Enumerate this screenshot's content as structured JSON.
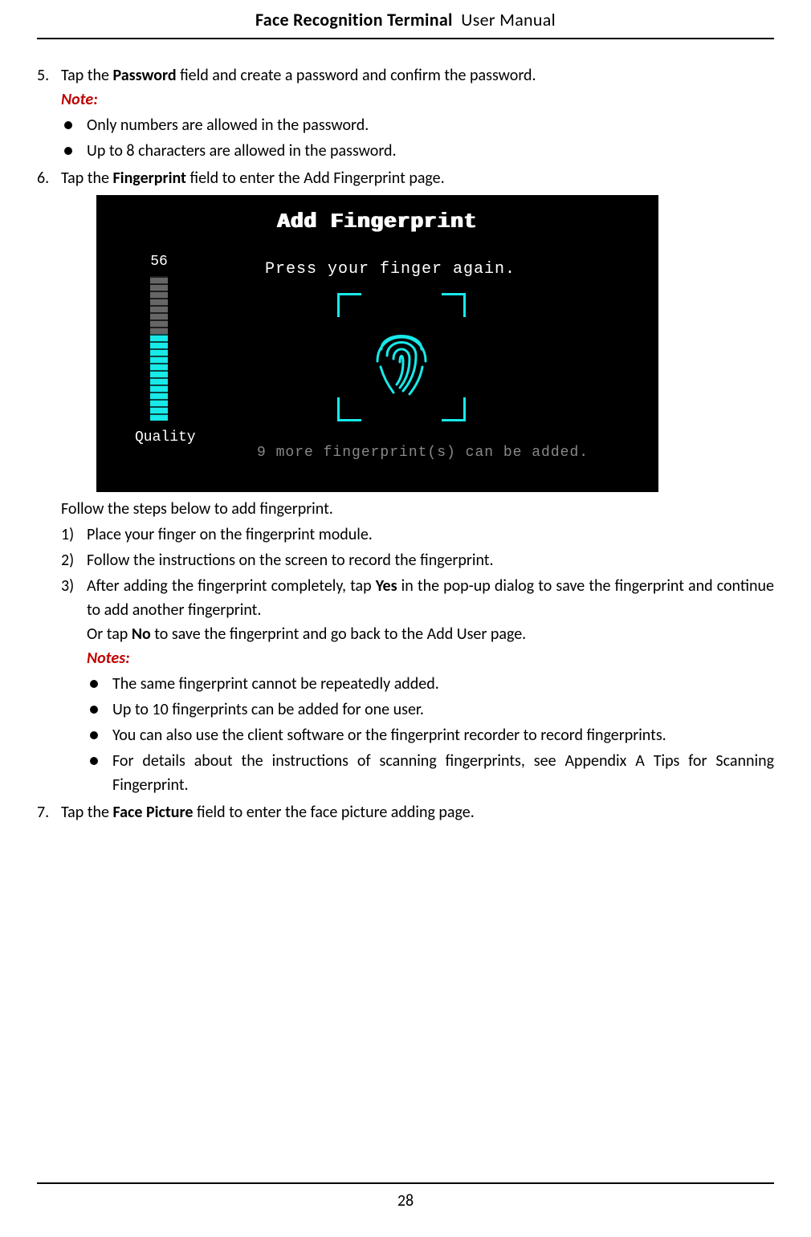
{
  "header": {
    "title_bold": "Face Recognition Terminal",
    "title_light": "User Manual"
  },
  "steps": {
    "s5": {
      "num": "5.",
      "text_pre": "Tap the ",
      "text_bold": "Password",
      "text_post": " field and create a password and confirm the password.",
      "note_label": "Note:",
      "bullets": [
        "Only numbers are allowed in the password.",
        "Up to 8 characters are allowed in the password."
      ]
    },
    "s6": {
      "num": "6.",
      "text_pre": "Tap the ",
      "text_bold": "Fingerprint",
      "text_post": " field to enter the Add Fingerprint page.",
      "screenshot": {
        "title": "Add Fingerprint",
        "quality_value": "56",
        "quality_label": "Quality",
        "prompt": "Press your finger again.",
        "remaining": "9 more fingerprint(s) can be added."
      },
      "follow_intro": "Follow the steps below to add fingerprint.",
      "substeps": {
        "a": {
          "num": "1)",
          "text": "Place your finger on the fingerprint module."
        },
        "b": {
          "num": "2)",
          "text": "Follow the instructions on the screen to record the fingerprint."
        },
        "c": {
          "num": "3)",
          "line1_pre": "After adding the fingerprint completely, tap ",
          "line1_bold": "Yes",
          "line1_post": " in the pop-up dialog to save the fingerprint and continue to add another fingerprint.",
          "line2_pre": "Or tap ",
          "line2_bold": "No",
          "line2_post": " to save the fingerprint and go back to the Add User page.",
          "notes_label": "Notes:",
          "note_bullets": [
            "The same fingerprint cannot be repeatedly added.",
            "Up to 10 fingerprints can be added for one user.",
            "You can also use the client software or the fingerprint recorder to record fingerprints.",
            "For details about the instructions of scanning fingerprints, see Appendix A  Tips for Scanning Fingerprint."
          ]
        }
      }
    },
    "s7": {
      "num": "7.",
      "text_pre": "Tap the ",
      "text_bold": "Face Picture",
      "text_post": " field to enter the face picture adding page."
    }
  },
  "page_number": "28"
}
